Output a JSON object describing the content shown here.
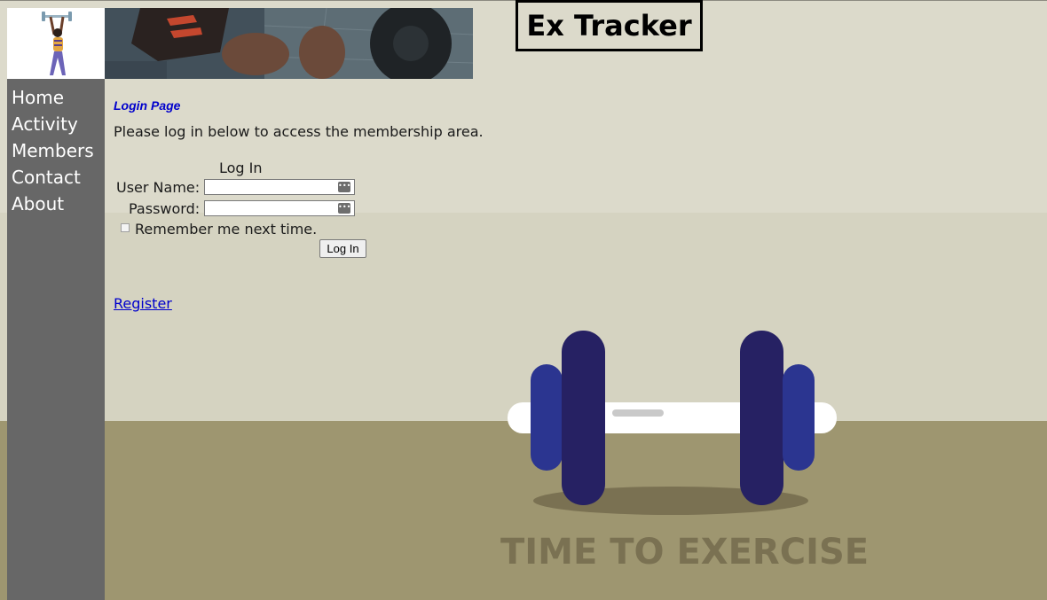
{
  "header": {
    "title": "Ex Tracker"
  },
  "nav": {
    "items": [
      {
        "label": "Home"
      },
      {
        "label": "Activity"
      },
      {
        "label": "Members"
      },
      {
        "label": "Contact"
      },
      {
        "label": "About"
      }
    ]
  },
  "main": {
    "heading": "Login Page",
    "intro": "Please log in below to access the membership area."
  },
  "login": {
    "title": "Log In",
    "username_label": "User Name:",
    "username_value": "",
    "password_label": "Password:",
    "password_value": "",
    "remember_label": "Remember me next time.",
    "remember_checked": false,
    "submit_label": "Log In"
  },
  "register_link": "Register",
  "illustration": {
    "slogan": "TIME TO EXERCISE"
  },
  "colors": {
    "sidebar": "#676767",
    "link": "#0000cc",
    "dumbbell_inner": "#262163",
    "dumbbell_outer": "#2b3590",
    "floor": "#9e9670"
  }
}
